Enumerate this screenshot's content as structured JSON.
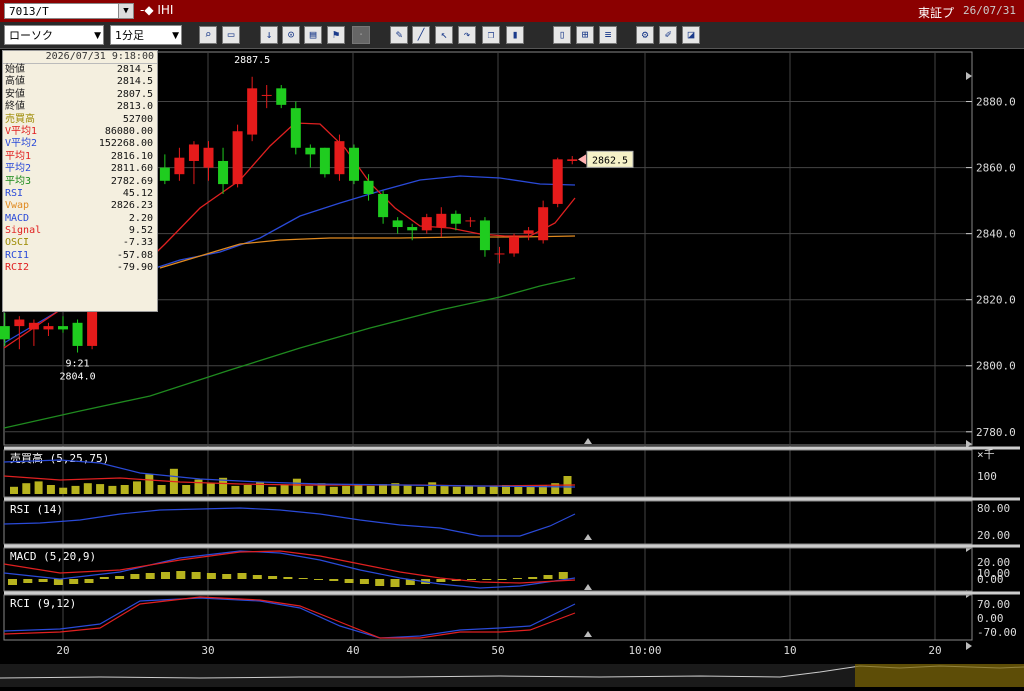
{
  "header": {
    "symbol": "7013/T",
    "name": "-◆ IHI",
    "exchange": "東証プ",
    "date": "26/07/31"
  },
  "toolbar": {
    "chart_type": "ローソク",
    "interval": "1分足",
    "icons": [
      "zoom-icon",
      "window-icon",
      "arrow-down-icon",
      "search-icon",
      "chart-icon",
      "flag-icon",
      "disabled-icon",
      "pen-icon",
      "line-icon",
      "cursor-icon",
      "redo-icon",
      "copy-icon",
      "trash-icon",
      "bars-icon",
      "ohlc-icon",
      "all-icon",
      "gear-icon",
      "brush-icon",
      "color-icon"
    ]
  },
  "info": {
    "timestamp": "2026/07/31 9:18:00",
    "rows": [
      {
        "label": "始値",
        "value": "2814.5",
        "color": "#222222"
      },
      {
        "label": "高値",
        "value": "2814.5",
        "color": "#222222"
      },
      {
        "label": "安値",
        "value": "2807.5",
        "color": "#222222"
      },
      {
        "label": "終値",
        "value": "2813.0",
        "color": "#222222"
      },
      {
        "label": "売買高",
        "value": "52700",
        "color": "#9c8a00"
      },
      {
        "label": "V平均1",
        "value": "86080.00",
        "color": "#e02020"
      },
      {
        "label": "V平均2",
        "value": "152268.00",
        "color": "#2a4ad8"
      },
      {
        "label": "平均1",
        "value": "2816.10",
        "color": "#e02020"
      },
      {
        "label": "平均2",
        "value": "2811.60",
        "color": "#2a4ad8"
      },
      {
        "label": "平均3",
        "value": "2782.69",
        "color": "#1a8a1a"
      },
      {
        "label": "RSI",
        "value": "45.12",
        "color": "#2a4ad8"
      },
      {
        "label": "Vwap",
        "value": "2826.23",
        "color": "#e08a20"
      },
      {
        "label": "MACD",
        "value": "2.20",
        "color": "#2a4ad8"
      },
      {
        "label": "Signal",
        "value": "9.52",
        "color": "#e02020"
      },
      {
        "label": "OSCI",
        "value": "-7.33",
        "color": "#9c8a00"
      },
      {
        "label": "RCI1",
        "value": "-57.08",
        "color": "#2a4ad8"
      },
      {
        "label": "RCI2",
        "value": "-79.90",
        "color": "#e02020"
      }
    ]
  },
  "chart_data": [
    {
      "type": "candlestick",
      "title": "",
      "y_ticks": [
        "2880.0",
        "2860.0",
        "2840.0",
        "2820.0",
        "2800.0",
        "2780.0"
      ],
      "ylim": [
        2776,
        2895
      ],
      "x_ticks": [
        "20",
        "30",
        "40",
        "50",
        "10:00",
        "10",
        "20"
      ],
      "candles": [
        {
          "t": 16,
          "o": 2812,
          "h": 2816,
          "l": 2806,
          "c": 2808
        },
        {
          "t": 17,
          "o": 2812,
          "h": 2815,
          "l": 2805,
          "c": 2814
        },
        {
          "t": 18,
          "o": 2811,
          "h": 2814,
          "l": 2806,
          "c": 2813
        },
        {
          "t": 19,
          "o": 2811,
          "h": 2813,
          "l": 2809,
          "c": 2812
        },
        {
          "t": 20,
          "o": 2812,
          "h": 2815,
          "l": 2810,
          "c": 2811
        },
        {
          "t": 21,
          "o": 2813,
          "h": 2814,
          "l": 2804,
          "c": 2806
        },
        {
          "t": 22,
          "o": 2806,
          "h": 2818,
          "l": 2805,
          "c": 2817
        },
        {
          "t": 23,
          "o": 2835,
          "h": 2848,
          "l": 2833,
          "c": 2846
        },
        {
          "t": 24,
          "o": 2846,
          "h": 2852,
          "l": 2844,
          "c": 2850
        },
        {
          "t": 25,
          "o": 2850,
          "h": 2854,
          "l": 2846,
          "c": 2849
        },
        {
          "t": 26,
          "o": 2850,
          "h": 2862,
          "l": 2848,
          "c": 2860
        },
        {
          "t": 27,
          "o": 2860,
          "h": 2864,
          "l": 2855,
          "c": 2856
        },
        {
          "t": 28,
          "o": 2858,
          "h": 2866,
          "l": 2856,
          "c": 2863
        },
        {
          "t": 29,
          "o": 2862,
          "h": 2868,
          "l": 2855,
          "c": 2867
        },
        {
          "t": 30,
          "o": 2860,
          "h": 2868,
          "l": 2856,
          "c": 2866
        },
        {
          "t": 31,
          "o": 2862,
          "h": 2866,
          "l": 2852,
          "c": 2855
        },
        {
          "t": 32,
          "o": 2855,
          "h": 2873,
          "l": 2854,
          "c": 2871
        },
        {
          "t": 33,
          "o": 2870,
          "h": 2887.5,
          "l": 2868,
          "c": 2884
        },
        {
          "t": 34,
          "o": 2882,
          "h": 2885,
          "l": 2878,
          "c": 2882
        },
        {
          "t": 35,
          "o": 2884,
          "h": 2885,
          "l": 2878,
          "c": 2879
        },
        {
          "t": 36,
          "o": 2878,
          "h": 2880,
          "l": 2864,
          "c": 2866
        },
        {
          "t": 37,
          "o": 2866,
          "h": 2867,
          "l": 2860,
          "c": 2864
        },
        {
          "t": 38,
          "o": 2866,
          "h": 2866,
          "l": 2857,
          "c": 2858
        },
        {
          "t": 39,
          "o": 2858,
          "h": 2870,
          "l": 2856,
          "c": 2868
        },
        {
          "t": 40,
          "o": 2866,
          "h": 2867,
          "l": 2855,
          "c": 2856
        },
        {
          "t": 41,
          "o": 2856,
          "h": 2858,
          "l": 2850,
          "c": 2852
        },
        {
          "t": 42,
          "o": 2852,
          "h": 2853,
          "l": 2843,
          "c": 2845
        },
        {
          "t": 43,
          "o": 2844,
          "h": 2845,
          "l": 2840,
          "c": 2842
        },
        {
          "t": 44,
          "o": 2842,
          "h": 2843,
          "l": 2838,
          "c": 2841
        },
        {
          "t": 45,
          "o": 2841,
          "h": 2846,
          "l": 2840,
          "c": 2845
        },
        {
          "t": 46,
          "o": 2842,
          "h": 2848,
          "l": 2839,
          "c": 2846
        },
        {
          "t": 47,
          "o": 2846,
          "h": 2847,
          "l": 2841,
          "c": 2843
        },
        {
          "t": 48,
          "o": 2844,
          "h": 2845,
          "l": 2842,
          "c": 2844
        },
        {
          "t": 49,
          "o": 2844,
          "h": 2845,
          "l": 2833,
          "c": 2835
        },
        {
          "t": 50,
          "o": 2834,
          "h": 2836,
          "l": 2831,
          "c": 2834
        },
        {
          "t": 51,
          "o": 2834,
          "h": 2840,
          "l": 2833,
          "c": 2839
        },
        {
          "t": 52,
          "o": 2840,
          "h": 2842,
          "l": 2838,
          "c": 2841
        },
        {
          "t": 53,
          "o": 2838,
          "h": 2850,
          "l": 2837,
          "c": 2848
        },
        {
          "t": 54,
          "o": 2849,
          "h": 2863,
          "l": 2848,
          "c": 2862.5
        },
        {
          "t": 55,
          "o": 2862,
          "h": 2863.5,
          "l": 2861,
          "c": 2862.5
        }
      ],
      "annotations": [
        {
          "text": "2887.5",
          "t": 33,
          "y": 2887.5
        },
        {
          "text": "9:21",
          "t": 21,
          "y": 2804
        },
        {
          "text": "2804.0",
          "t": 21,
          "y": 2804
        }
      ],
      "last_price": "2862.5"
    },
    {
      "type": "bar",
      "title": "売買高 (5,25,75)",
      "y_ticks": [
        "×千",
        "100"
      ]
    },
    {
      "type": "line",
      "title": "RSI (14)",
      "y_ticks": [
        "80.00",
        "20.00"
      ]
    },
    {
      "type": "line",
      "title": "MACD (5,20,9)",
      "y_ticks": [
        "20.00",
        "10.00",
        "0.00"
      ]
    },
    {
      "type": "line",
      "title": "RCI (9,12)",
      "y_ticks": [
        "70.00",
        "0.00",
        "-70.00"
      ]
    }
  ]
}
